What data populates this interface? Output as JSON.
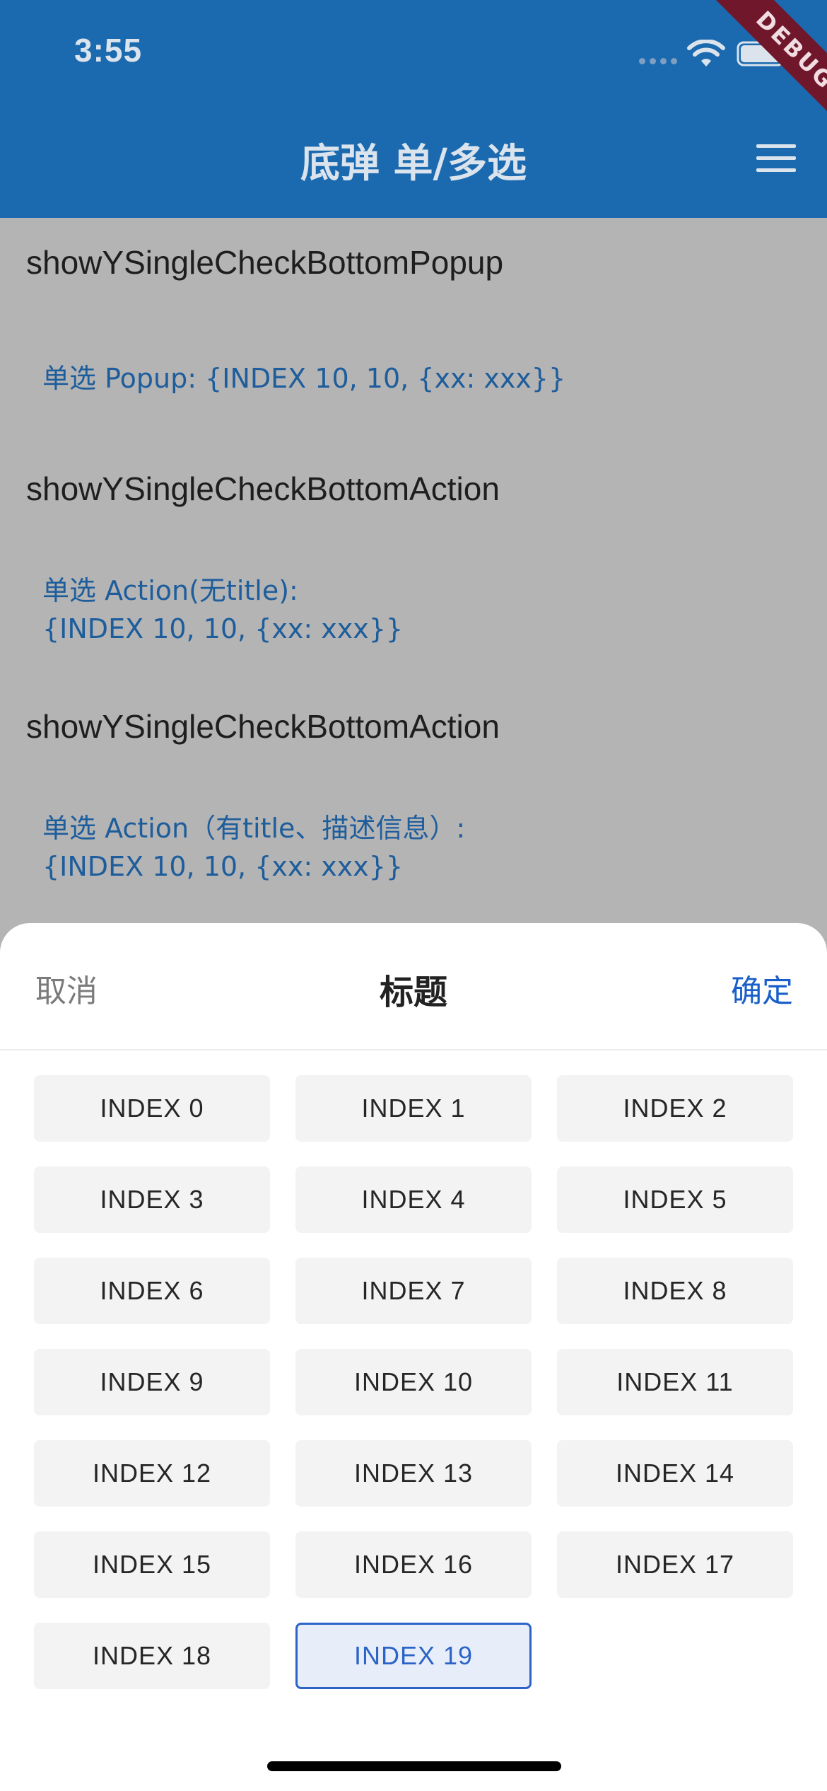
{
  "status_bar": {
    "time": "3:55"
  },
  "app_bar": {
    "title": "底弹 单/多选",
    "debug_label": "DEBUG"
  },
  "content": {
    "sections": [
      {
        "title": "showYSingleCheckBottomPopup",
        "button_lines": [
          "单选 Popup: {INDEX 10, 10, {xx: xxx}}"
        ]
      },
      {
        "title": "showYSingleCheckBottomAction",
        "button_lines": [
          "单选 Action(无title):",
          "{INDEX 10, 10, {xx: xxx}}"
        ]
      },
      {
        "title": "showYSingleCheckBottomAction",
        "button_lines": [
          "单选 Action（有title、描述信息）:",
          "{INDEX 10, 10, {xx: xxx}}"
        ]
      }
    ]
  },
  "sheet": {
    "cancel_label": "取消",
    "title": "标题",
    "confirm_label": "确定",
    "selected_index": 19,
    "options": [
      "INDEX 0",
      "INDEX 1",
      "INDEX 2",
      "INDEX 3",
      "INDEX 4",
      "INDEX 5",
      "INDEX 6",
      "INDEX 7",
      "INDEX 8",
      "INDEX 9",
      "INDEX 10",
      "INDEX 11",
      "INDEX 12",
      "INDEX 13",
      "INDEX 14",
      "INDEX 15",
      "INDEX 16",
      "INDEX 17",
      "INDEX 18",
      "INDEX 19"
    ]
  },
  "colors": {
    "app_bar": "#1b6ab0",
    "accent": "#2b63c6",
    "link": "#1e5d9c",
    "debug_banner": "#70172b"
  }
}
